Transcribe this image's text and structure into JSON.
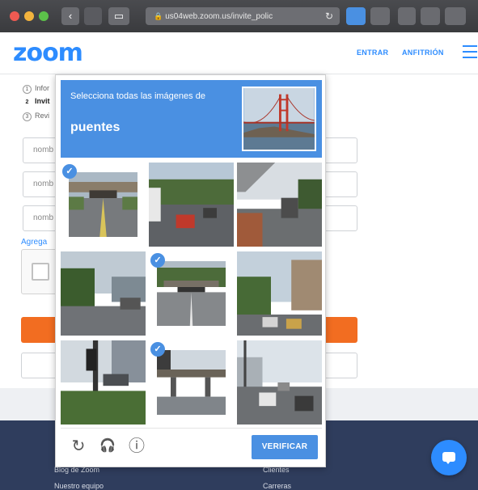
{
  "browser": {
    "url": "us04web.zoom.us/invite_polic",
    "back_glyph": "‹",
    "sidebar_glyph": "▭",
    "reload_glyph": "↻",
    "lock_glyph": "🔒"
  },
  "header": {
    "logo": "zoom",
    "nav": [
      "ENTRAR",
      "ANFITRIÓN"
    ]
  },
  "steps": [
    {
      "num": "1",
      "label": "Infor"
    },
    {
      "num": "2",
      "label": "Invit"
    },
    {
      "num": "3",
      "label": "Revi"
    }
  ],
  "form": {
    "fields": [
      "nomb",
      "nomb",
      "nomb"
    ],
    "add_link": "Agrega"
  },
  "captcha": {
    "instruction": "Selecciona todas las imágenes de",
    "target": "puentes",
    "verify_label": "VERIFICAR",
    "tiles": [
      {
        "selected": true
      },
      {
        "selected": false
      },
      {
        "selected": false
      },
      {
        "selected": false
      },
      {
        "selected": true
      },
      {
        "selected": false
      },
      {
        "selected": false
      },
      {
        "selected": true
      },
      {
        "selected": false
      }
    ],
    "check_glyph": "✓",
    "reload_icon": "↻",
    "audio_icon": "🎧",
    "info_icon": "ⓘ"
  },
  "footer": {
    "links": [
      "Blog de Zoom",
      "Nuestro equipo",
      "Clientes",
      "Carreras"
    ]
  },
  "colors": {
    "zoom_blue": "#2d8cff",
    "captcha_blue": "#4a90e2",
    "orange": "#f26d21",
    "footer": "#2f3d5d"
  }
}
